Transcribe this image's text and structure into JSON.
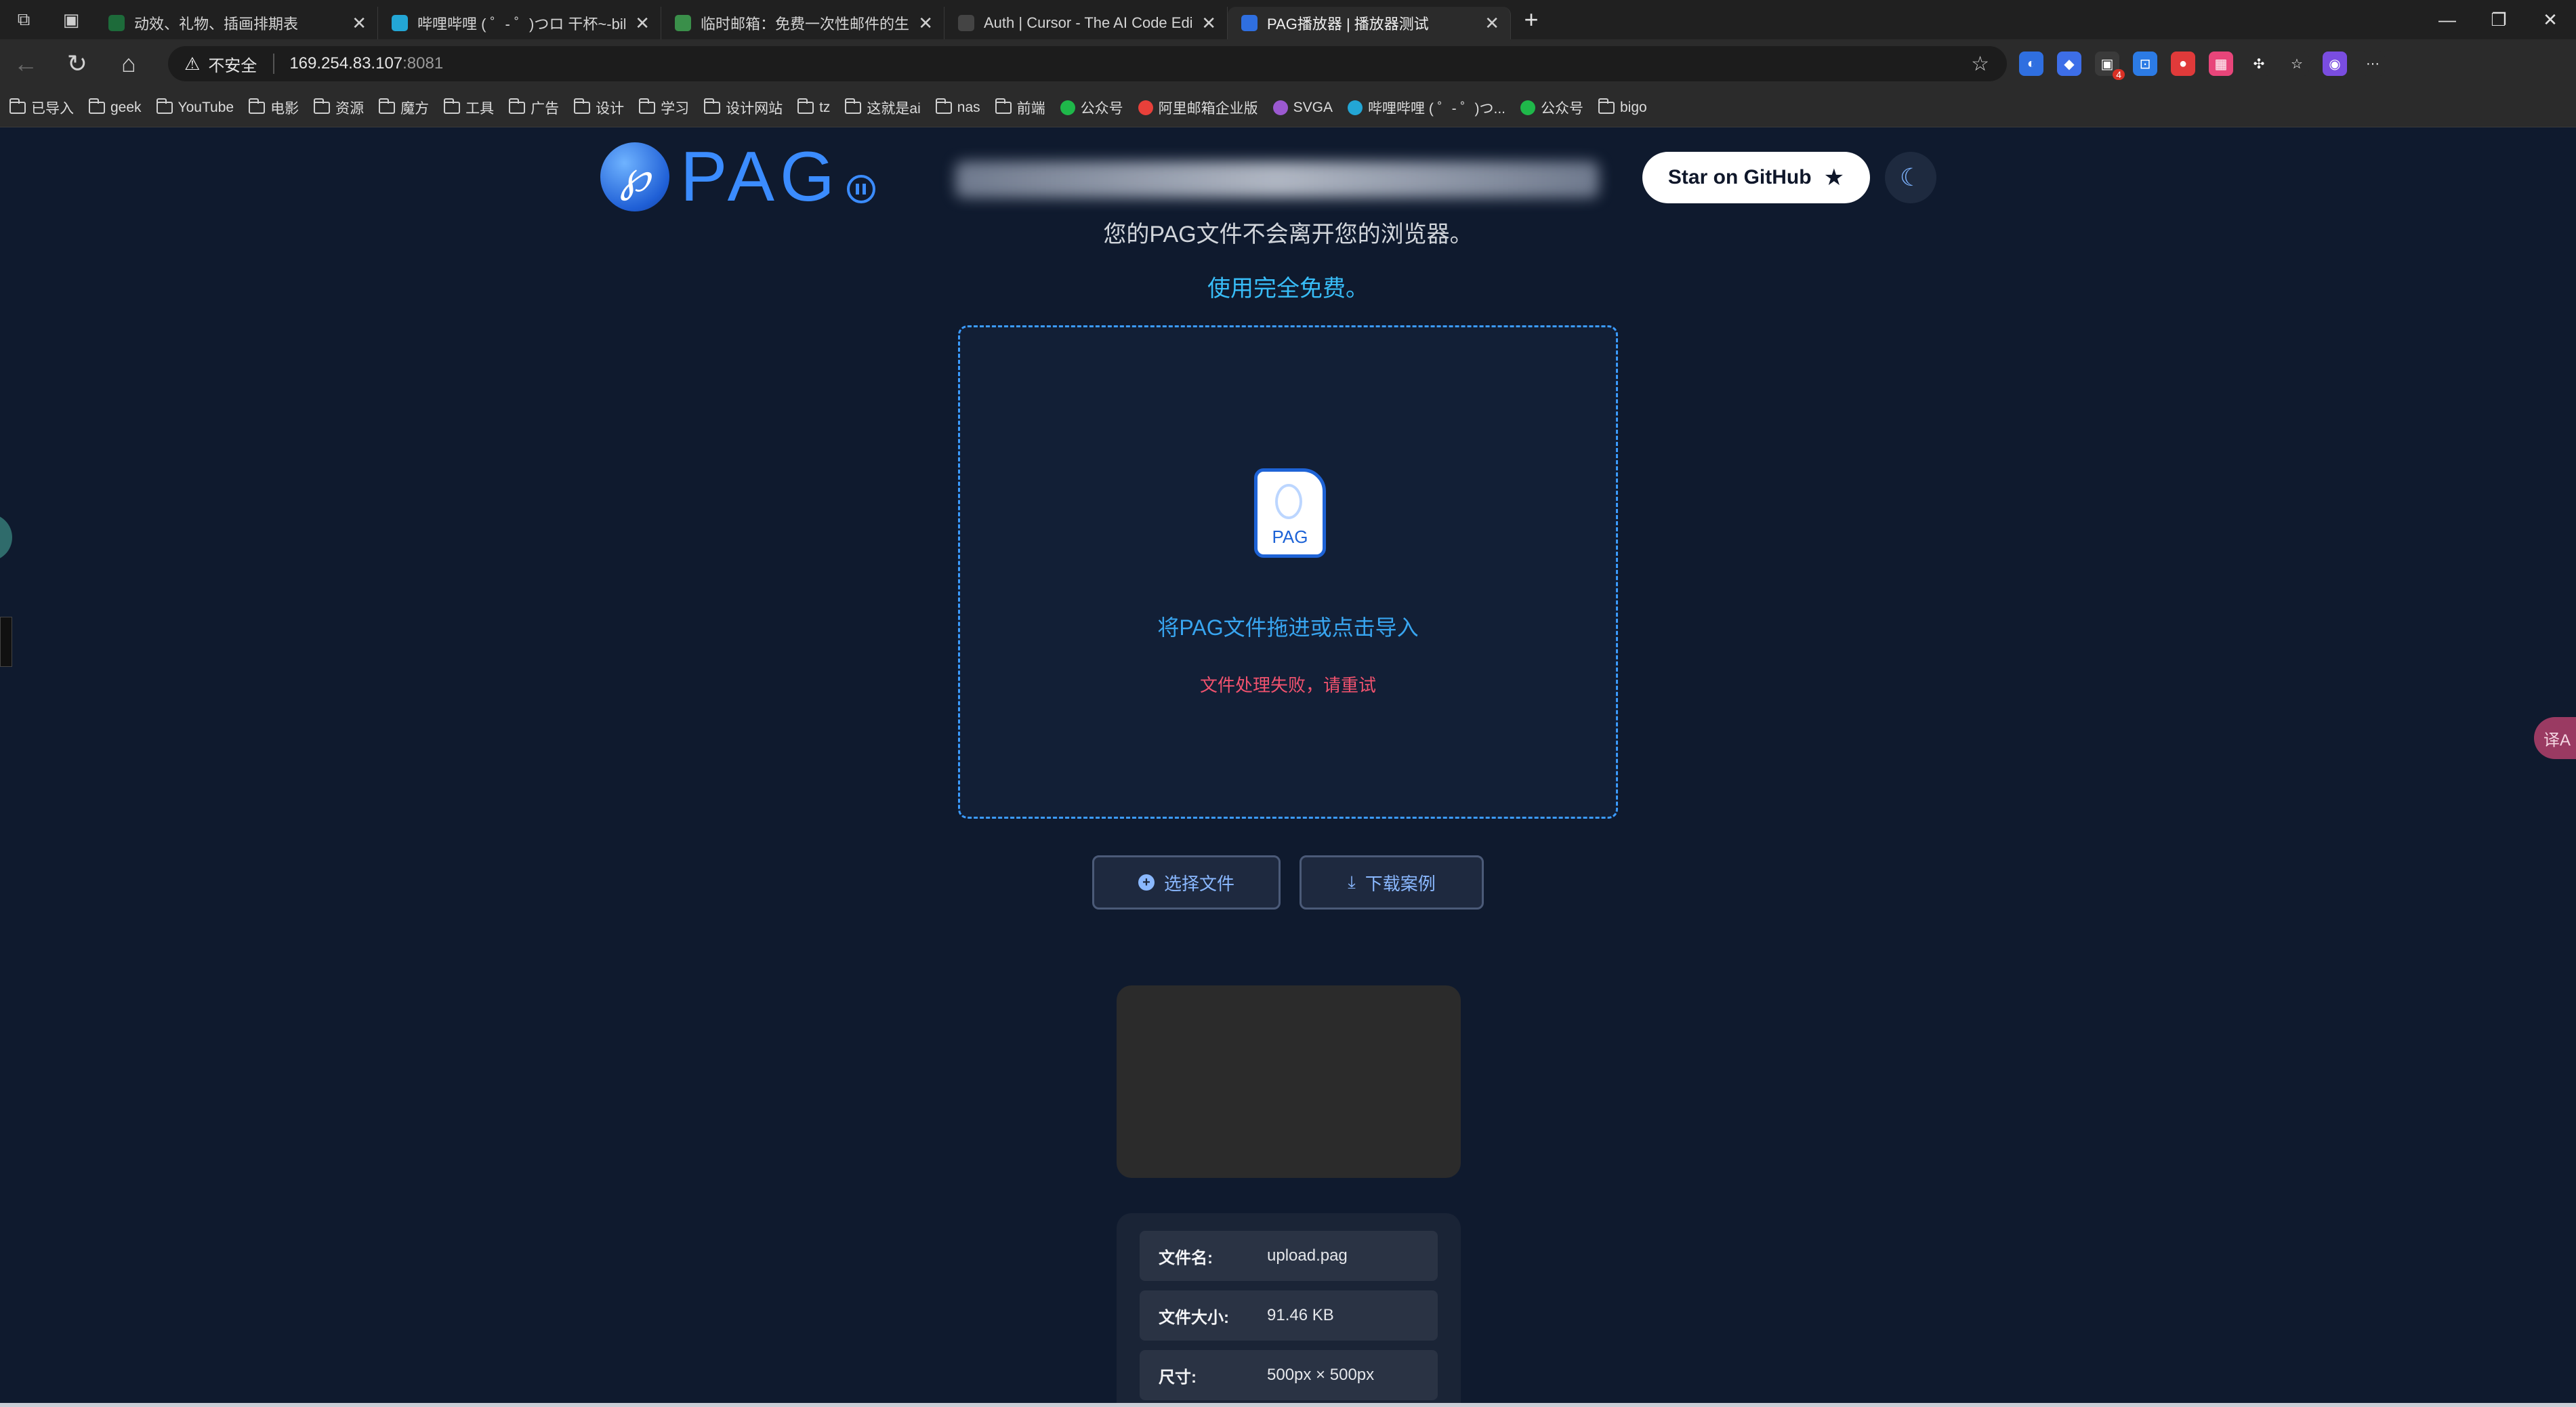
{
  "browser": {
    "tabs": [
      {
        "title": "动效、礼物、插画排期表",
        "favicon_color": "#1d6b3a",
        "active": false
      },
      {
        "title": "哔哩哔哩 ( ゜- ゜)つロ 干杯~-bilibili",
        "favicon_color": "#23a6d5",
        "active": false
      },
      {
        "title": "临时邮箱：免费一次性邮件的生成器",
        "favicon_color": "#3a8f4a",
        "active": false
      },
      {
        "title": "Auth | Cursor - The AI Code Editor",
        "favicon_color": "#444444",
        "active": false
      },
      {
        "title": "PAG播放器 | 播放器测试",
        "favicon_color": "#2f6fe0",
        "active": true
      }
    ],
    "address": {
      "security_label": "不安全",
      "host": "169.254.83.107",
      "port": ":8081"
    },
    "extensions": [
      {
        "name": "edge-ext-icon",
        "color": "#2f6fe0",
        "glyph": "◐"
      },
      {
        "name": "shield-ext-icon",
        "color": "#3d6ee8",
        "glyph": "◆"
      },
      {
        "name": "gamepad-ext-icon",
        "color": "#3a3a3a",
        "glyph": "▣",
        "badge": "4"
      },
      {
        "name": "translate-ext-icon",
        "color": "#2c7be5",
        "glyph": "⊡"
      },
      {
        "name": "red-ext-icon",
        "color": "#e03a3a",
        "glyph": "●"
      },
      {
        "name": "pink-ext-icon",
        "color": "#e8457a",
        "glyph": "▦"
      },
      {
        "name": "puzzle-ext-icon",
        "color": "#2b2b2b",
        "glyph": "✣"
      },
      {
        "name": "favorites-icon",
        "color": "#2b2b2b",
        "glyph": "☆"
      },
      {
        "name": "profile-avatar",
        "color": "#7a4de0",
        "glyph": "◉"
      },
      {
        "name": "more-icon",
        "color": "#2b2b2b",
        "glyph": "···"
      }
    ],
    "bookmarks": [
      {
        "label": "已导入",
        "type": "folder"
      },
      {
        "label": "geek",
        "type": "folder"
      },
      {
        "label": "YouTube",
        "type": "folder"
      },
      {
        "label": "电影",
        "type": "folder"
      },
      {
        "label": "资源",
        "type": "folder"
      },
      {
        "label": "魔方",
        "type": "folder"
      },
      {
        "label": "工具",
        "type": "folder"
      },
      {
        "label": "广告",
        "type": "folder"
      },
      {
        "label": "设计",
        "type": "folder"
      },
      {
        "label": "学习",
        "type": "folder"
      },
      {
        "label": "设计网站",
        "type": "folder"
      },
      {
        "label": "tz",
        "type": "folder"
      },
      {
        "label": "这就是ai",
        "type": "folder"
      },
      {
        "label": "nas",
        "type": "folder"
      },
      {
        "label": "前端",
        "type": "folder"
      },
      {
        "label": "公众号",
        "type": "site",
        "color": "#1fb84a"
      },
      {
        "label": "阿里邮箱企业版",
        "type": "site",
        "color": "#e8403a"
      },
      {
        "label": "SVGA",
        "type": "site",
        "color": "#9b59d0"
      },
      {
        "label": "哔哩哔哩 ( ゜- ゜)つ...",
        "type": "site",
        "color": "#23a6d5"
      },
      {
        "label": "公众号",
        "type": "site",
        "color": "#1fb84a"
      },
      {
        "label": "bigo",
        "type": "folder"
      }
    ]
  },
  "page": {
    "logo_text": "PAG",
    "logo_glyph": "℘",
    "github_label": "Star on GitHub",
    "subtitle_privacy": "您的PAG文件不会离开您的浏览器。",
    "subtitle_free": "使用完全免费。",
    "dropzone": {
      "file_icon_label": "PAG",
      "prompt": "将PAG文件拖进或点击导入",
      "error": "文件处理失败，请重试"
    },
    "buttons": {
      "select_file": "选择文件",
      "download_sample": "下载案例"
    },
    "file_info": [
      {
        "key": "文件名:",
        "value": "upload.pag"
      },
      {
        "key": "文件大小:",
        "value": "91.46 KB"
      },
      {
        "key": "尺寸:",
        "value": "500px × 500px"
      }
    ],
    "side_widget_label": "译A",
    "colors": {
      "background": "#0f1a2e",
      "accent_blue": "#3b8cff",
      "link_cyan": "#38bdf8",
      "error_red": "#f0526e"
    }
  }
}
